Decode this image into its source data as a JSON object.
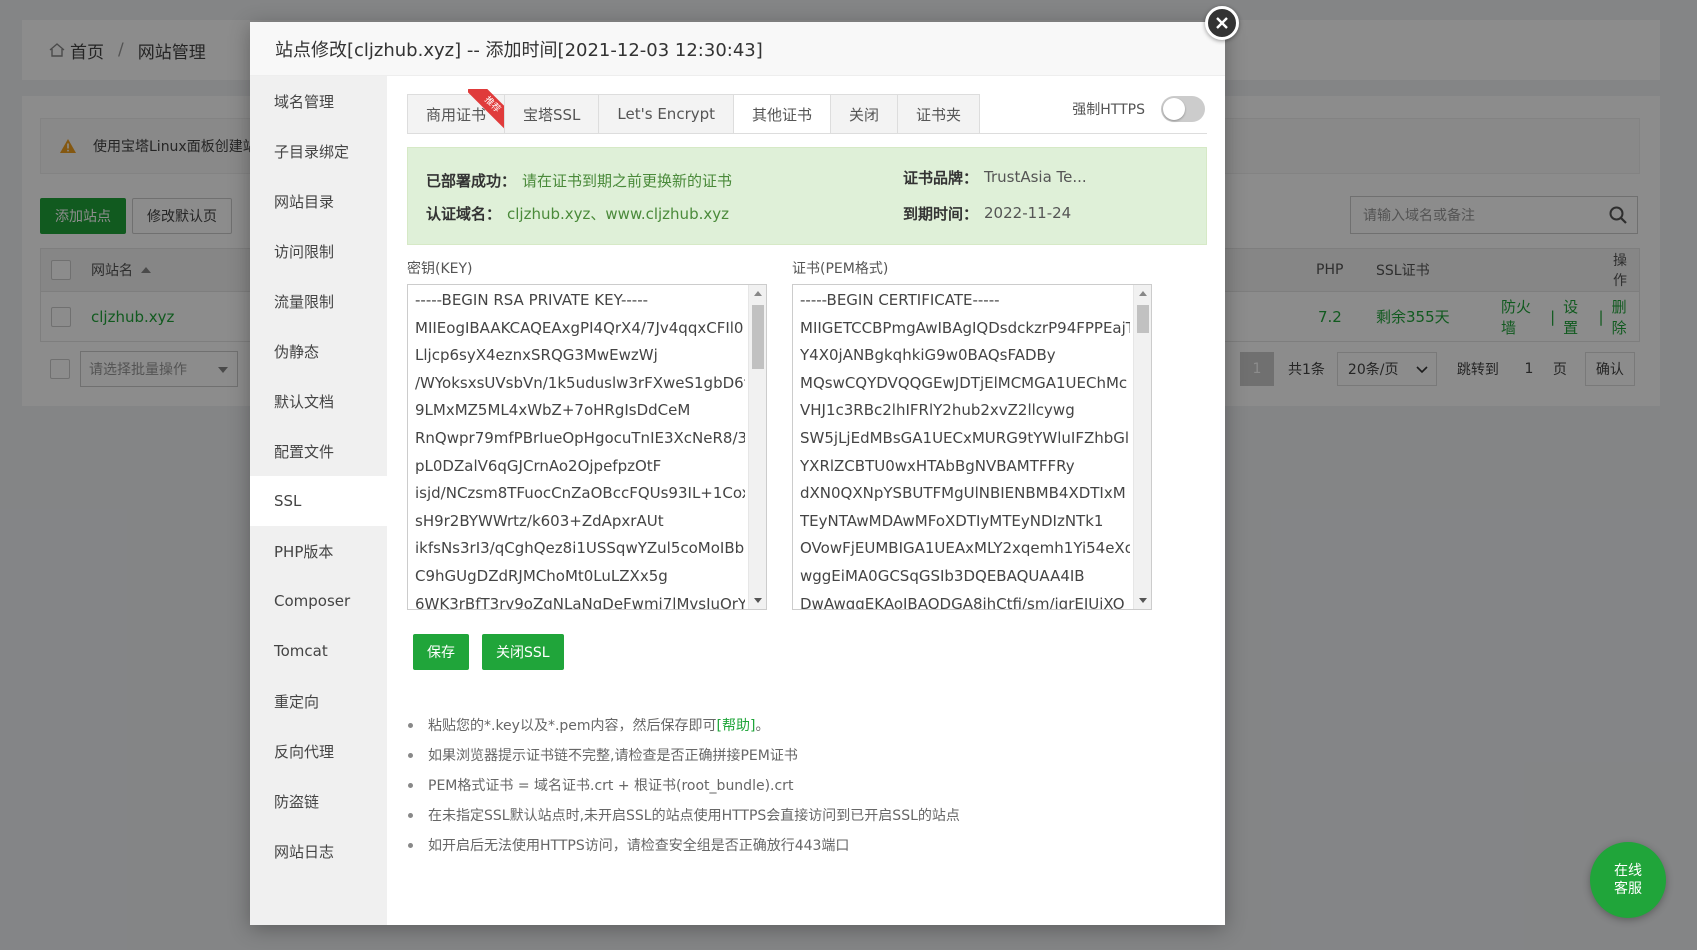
{
  "background": {
    "breadcrumb": {
      "home": "首页",
      "separator": "/",
      "current": "网站管理"
    },
    "warning_text": "使用宝塔Linux面板创建站",
    "buttons": {
      "add_site": "添加站点",
      "modify_default": "修改默认页"
    },
    "search_placeholder": "请输入域名或备注",
    "table": {
      "headers": {
        "site_name": "网站名",
        "php": "PHP",
        "ssl": "SSL证书",
        "ops": "操作"
      },
      "row": {
        "name": "cljzhub.xyz",
        "php": "7.2",
        "ssl": "剩余355天",
        "op_firewall": "防火墙",
        "op_settings": "设置",
        "op_delete": "删除",
        "op_sep": "|"
      }
    },
    "batch_placeholder": "请选择批量操作",
    "pager": {
      "current": "1",
      "total": "共1条",
      "per_page": "20条/页",
      "jump_label": "跳转到",
      "jump_value": "1",
      "page_unit": "页",
      "confirm": "确认"
    },
    "chat": {
      "line1": "在线",
      "line2": "客服"
    }
  },
  "modal": {
    "title": "站点修改[cljzhub.xyz] -- 添加时间[2021-12-03 12:30:43]",
    "sidebar": [
      "域名管理",
      "子目录绑定",
      "网站目录",
      "访问限制",
      "流量限制",
      "伪静态",
      "默认文档",
      "配置文件",
      "SSL",
      "PHP版本",
      "Composer",
      "Tomcat",
      "重定向",
      "反向代理",
      "防盗链",
      "网站日志"
    ],
    "sidebar_active_index": 8,
    "tabs": [
      "商用证书",
      "宝塔SSL",
      "Let's Encrypt",
      "其他证书",
      "关闭",
      "证书夹"
    ],
    "tab_active_index": 3,
    "tab_ribbon": "推荐",
    "force_https_label": "强制HTTPS",
    "force_https_on": false,
    "status": {
      "deployed_label": "已部署成功：",
      "deployed_value": "请在证书到期之前更换新的证书",
      "brand_label": "证书品牌：",
      "brand_value": "TrustAsia Te...",
      "domain_label": "认证域名：",
      "domain_value": "cljzhub.xyz、www.cljzhub.xyz",
      "expire_label": "到期时间：",
      "expire_value": "2022-11-24"
    },
    "key_label": "密钥(KEY)",
    "key_lines": [
      "-----BEGIN RSA PRIVATE KEY-----",
      "MIIEogIBAAKCAQEAxgPI4QrX4/7Jv4qqxCFIl0",
      "Lljcp6syX4eznxSRQG3MwEwzWj",
      "/WYoksxsUVsbVn/1k5uduslw3rFXweS1gbD6f",
      "9LMxMZ5ML4xWbZ+7oHRgIsDdCeM",
      "RnQwpr79mfPBrIueOpHgocuTnIE3XcNeR8/3",
      "pL0DZalV6qGJCrnAo2OjpefpzOtF",
      "isjd/NCzsm8TFuocCnZaOBccFQUs93IL+1Cox",
      "sH9r2BYWWrtz/k603+ZdApxrAUt",
      "ikfsNs3rI3/qCghQez8i1USSqwYZul5coMoIBb",
      "C9hGUgDZdRJMChoMt0LuLZXx5g",
      "6WK3rBfT3rv9oZqNLaNgDeFwmi7lMvsIuOrY"
    ],
    "cert_label": "证书(PEM格式)",
    "cert_lines": [
      "-----BEGIN CERTIFICATE-----",
      "MIIGETCCBPmgAwIBAgIQDsdckzrP94FPPEajT",
      "Y4X0jANBgkqhkiG9w0BAQsFADBy",
      "MQswCQYDVQQGEwJDTjElMCMGA1UEChMc",
      "VHJ1c3RBc2lhIFRlY2hub2xvZ2llcywg",
      "SW5jLjEdMBsGA1UECxMURG9tYWluIFZhbGlk",
      "YXRlZCBTU0wxHTAbBgNVBAMTFFRy",
      "dXN0QXNpYSBUTFMgUlNBIENBMB4XDTIxM",
      "TEyNTAwMDAwMFoXDTIyMTEyNDIzNTk1",
      "OVowFjEUMBIGA1UEAxMLY2xqemh1Yi54eXo",
      "wggEiMA0GCSqGSIb3DQEBAQUAA4IB",
      "DwAwggEKAoIBAQDGA8ihCtfi/sm/iqrEIUiXO"
    ],
    "buttons": {
      "save": "保存",
      "close_ssl": "关闭SSL"
    },
    "tips": {
      "t1_before": "粘贴您的*.key以及*.pem内容，然后保存即可",
      "t1_link": "[帮助]",
      "t1_after": "。",
      "t2": "如果浏览器提示证书链不完整,请检查是否正确拼接PEM证书",
      "t3": "PEM格式证书 = 域名证书.crt + 根证书(root_bundle).crt",
      "t4": "在未指定SSL默认站点时,未开启SSL的站点使用HTTPS会直接访问到已开启SSL的站点",
      "t5": "如开启后无法使用HTTPS访问，请检查安全组是否正确放行443端口"
    }
  },
  "colors": {
    "accent": "#20a53a",
    "status_bg": "#dff0d8",
    "ribbon": "#e03b3b"
  }
}
